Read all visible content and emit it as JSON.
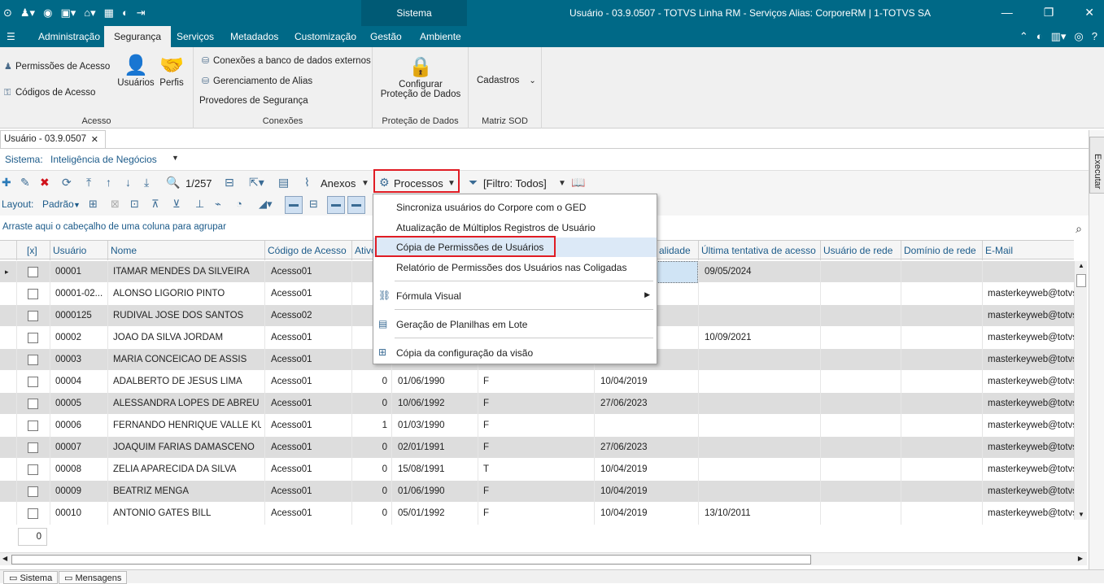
{
  "window": {
    "system_tab": "Sistema",
    "title": "Usuário - 03.9.0507 - TOTVS Linha RM - Serviços  Alias: CorporeRM | 1-TOTVS SA"
  },
  "menu": {
    "items": [
      "Administração",
      "Segurança",
      "Serviços",
      "Metadados",
      "Customização",
      "Gestão",
      "Ambiente"
    ],
    "active": "Segurança"
  },
  "ribbon": {
    "acesso": {
      "items": [
        "Permissões de Acesso",
        "Códigos de Acesso"
      ],
      "usuarios": "Usuários",
      "perfis": "Perfis",
      "label": "Acesso"
    },
    "conexoes": {
      "items": [
        "Conexões a banco de dados externos",
        "Gerenciamento de Alias",
        "Provedores de Segurança"
      ],
      "label": "Conexões"
    },
    "protecao": {
      "button_line1": "Configurar",
      "button_line2": "Proteção de Dados",
      "label": "Proteção de Dados"
    },
    "sod": {
      "cadastros": "Cadastros",
      "label": "Matriz SOD"
    }
  },
  "doc_tab": {
    "label": "Usuário - 03.9.0507"
  },
  "sistema": {
    "label": "Sistema:",
    "value": "Inteligência de Negócios"
  },
  "toolbar": {
    "record_count": "1/257",
    "anexos": "Anexos",
    "processos": "Processos",
    "filtro": "[Filtro: Todos]",
    "layout_label": "Layout:",
    "padrao": "Padrão"
  },
  "group_hint": "Arraste aqui o cabeçalho de uma coluna para agrupar",
  "grid": {
    "columns": [
      "[x]",
      "Usuário",
      "Nome",
      "Código de Acesso",
      "Ativo",
      "",
      "",
      "alidade",
      "Última tentativa de acesso",
      "Usuário de rede",
      "Domínio de rede",
      "E-Mail"
    ],
    "rows": [
      {
        "usuario": "00001",
        "nome": "ITAMAR MENDES DA SILVEIRA",
        "codigo": "Acesso01",
        "ativo": "",
        "data": "",
        "tipo": "",
        "validade": "",
        "ultima": "09/05/2024",
        "email": ""
      },
      {
        "usuario": "00001-02...",
        "nome": "ALONSO LIGORIO PINTO",
        "codigo": "Acesso01",
        "ativo": "",
        "data": "",
        "tipo": "",
        "validade": "",
        "ultima": "",
        "email": "masterkeyweb@totvs"
      },
      {
        "usuario": "0000125",
        "nome": "RUDIVAL JOSE DOS SANTOS",
        "codigo": "Acesso02",
        "ativo": "",
        "data": "",
        "tipo": "",
        "validade": "",
        "ultima": "",
        "email": "masterkeyweb@totvs"
      },
      {
        "usuario": "00002",
        "nome": "JOAO DA SILVA JORDAM",
        "codigo": "Acesso01",
        "ativo": "",
        "data": "",
        "tipo": "",
        "validade": "",
        "ultima": "10/09/2021",
        "email": "masterkeyweb@totvs"
      },
      {
        "usuario": "00003",
        "nome": "MARIA CONCEICAO DE ASSIS",
        "codigo": "Acesso01",
        "ativo": "",
        "data": "",
        "tipo": "",
        "validade": "",
        "ultima": "",
        "email": "masterkeyweb@totvs"
      },
      {
        "usuario": "00004",
        "nome": "ADALBERTO DE JESUS LIMA",
        "codigo": "Acesso01",
        "ativo": "0",
        "data": "01/06/1990",
        "tipo": "F",
        "validade": "10/04/2019",
        "ultima": "",
        "email": "masterkeyweb@totvs"
      },
      {
        "usuario": "00005",
        "nome": "ALESSANDRA LOPES DE ABREU",
        "codigo": "Acesso01",
        "ativo": "0",
        "data": "10/06/1992",
        "tipo": "F",
        "validade": "27/06/2023",
        "ultima": "",
        "email": "masterkeyweb@totvs"
      },
      {
        "usuario": "00006",
        "nome": "FERNANDO HENRIQUE VALLE KUR...",
        "codigo": "Acesso01",
        "ativo": "1",
        "data": "01/03/1990",
        "tipo": "F",
        "validade": "",
        "ultima": "",
        "email": "masterkeyweb@totvs"
      },
      {
        "usuario": "00007",
        "nome": "JOAQUIM FARIAS DAMASCENO",
        "codigo": "Acesso01",
        "ativo": "0",
        "data": "02/01/1991",
        "tipo": "F",
        "validade": "27/06/2023",
        "ultima": "",
        "email": "masterkeyweb@totvs"
      },
      {
        "usuario": "00008",
        "nome": "ZELIA APARECIDA DA SILVA",
        "codigo": "Acesso01",
        "ativo": "0",
        "data": "15/08/1991",
        "tipo": "T",
        "validade": "10/04/2019",
        "ultima": "",
        "email": "masterkeyweb@totvs"
      },
      {
        "usuario": "00009",
        "nome": "BEATRIZ MENGA",
        "codigo": "Acesso01",
        "ativo": "0",
        "data": "01/06/1990",
        "tipo": "F",
        "validade": "10/04/2019",
        "ultima": "",
        "email": "masterkeyweb@totvs"
      },
      {
        "usuario": "00010",
        "nome": "ANTONIO GATES BILL",
        "codigo": "Acesso01",
        "ativo": "0",
        "data": "05/01/1992",
        "tipo": "F",
        "validade": "10/04/2019",
        "ultima": "13/10/2011",
        "email": "masterkeyweb@totvs"
      }
    ]
  },
  "footer_count": "0",
  "dropdown": {
    "items": [
      "Sincroniza usuários do Corpore com o GED",
      "Atualização de Múltiplos Registros de Usuário",
      "Cópia de Permissões de Usuários",
      "Relatório de Permissões dos Usuários nas Coligadas",
      "Fórmula Visual",
      "Geração de Planilhas em Lote",
      "Cópia da configuração da visão"
    ]
  },
  "bottom_tabs": [
    "Sistema",
    "Mensagens"
  ],
  "side_pane": {
    "executar": "Executar"
  },
  "colors": {
    "titlebar": "#006987",
    "highlight": "#e01c24",
    "row_alt": "#dddddd"
  }
}
